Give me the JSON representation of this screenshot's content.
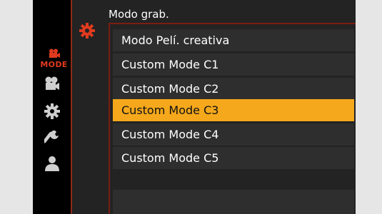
{
  "menu": {
    "title": "Modo grab.",
    "items": [
      {
        "label": "Modo Pelí. creativa"
      },
      {
        "label": "Custom Mode C1"
      },
      {
        "label": "Custom Mode C2"
      },
      {
        "label": "Custom Mode C3"
      },
      {
        "label": "Custom Mode C4"
      },
      {
        "label": "Custom Mode C5"
      },
      {
        "label": ""
      }
    ],
    "selected_index": 3
  },
  "tabs": {
    "mode_label": "MODE",
    "icons": [
      "movie-camera-icon",
      "gear-icon",
      "wrench-icon",
      "person-icon"
    ]
  },
  "colors": {
    "accent_red": "#e03a1e",
    "selected_bg": "#f5a81b",
    "item_bg": "#2e2e2e"
  }
}
